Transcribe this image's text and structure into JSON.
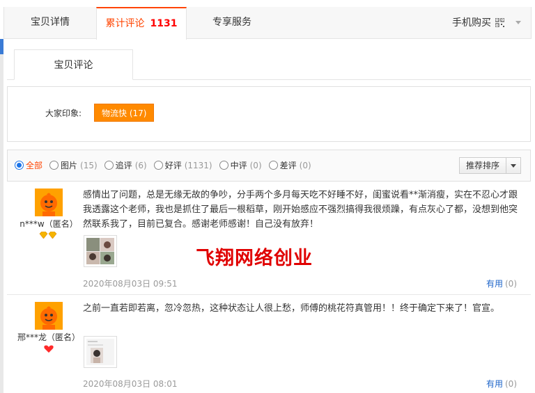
{
  "tabs": {
    "details": "宝贝详情",
    "reviews": "累计评论",
    "reviews_count": "1131",
    "service": "专享服务",
    "mobile_buy": "手机购买"
  },
  "subtab": {
    "label": "宝贝评论"
  },
  "impressions": {
    "label": "大家印象:",
    "tag": "物流快 (17)"
  },
  "filters": [
    {
      "label": "全部",
      "count": "",
      "selected": true
    },
    {
      "label": "图片",
      "count": "(15)",
      "selected": false
    },
    {
      "label": "追评",
      "count": "(6)",
      "selected": false
    },
    {
      "label": "好评",
      "count": "(1131)",
      "selected": false
    },
    {
      "label": "中评",
      "count": "(0)",
      "selected": false
    },
    {
      "label": "差评",
      "count": "(0)",
      "selected": false
    }
  ],
  "sort": {
    "label": "推荐排序"
  },
  "reviews": [
    {
      "user": "n***w（匿名）",
      "text": "感情出了问题，总是无缘无故的争吵，分手两个多月每天吃不好睡不好，闺蜜说看**渐消瘦，实在不忍心才跟我透露这个老师，我也是抓住了最后一根稻草，刚开始感应不强烈搞得我很烦躁，有点灰心了都，没想到他突然联系我了，目前已复合。感谢老师感谢！自己没有放弃！",
      "date": "2020年08月03日 09:51",
      "useful_label": "有用",
      "useful_count": "(0)"
    },
    {
      "user": "邢***龙（匿名）",
      "text": "之前一直若即若离，忽冷忽热，这种状态让人很上愁，师傅的桃花符真管用！！终于确定下来了！官宣。",
      "date": "2020年08月03日 08:01",
      "useful_label": "有用",
      "useful_count": "(0)"
    }
  ],
  "watermark": "飞翔网络创业",
  "colors": {
    "accent": "#ff4400",
    "tag": "#ff8a00",
    "link": "#1d64c9",
    "watermark": "#e00000"
  }
}
